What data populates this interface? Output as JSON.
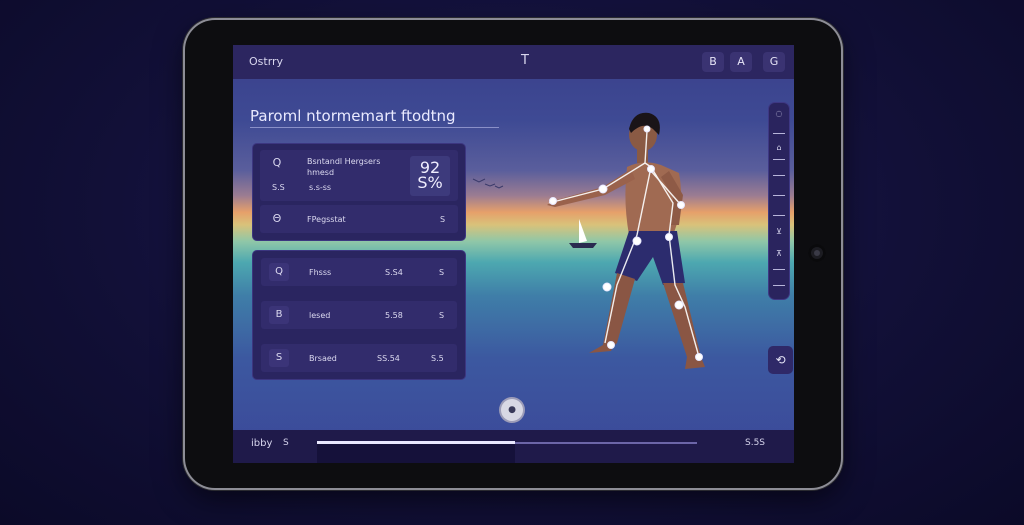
{
  "app": {
    "title": "Ostrry",
    "center_icon": "T",
    "top_buttons": [
      "B",
      "A",
      "G"
    ]
  },
  "main": {
    "heading": "Paroml ntormemart ftodtng"
  },
  "card1": {
    "row1": {
      "icon": "Q",
      "line1": "Bsntandl Hergsers",
      "line2": "hmesd",
      "qr_label": "92\nS%",
      "sub_icon": "S.S",
      "sub_text": "s.s-ss"
    },
    "row2": {
      "icon": "Θ",
      "label": "FPegsstat",
      "right": "S"
    }
  },
  "card2": {
    "rows": [
      {
        "icon": "Q",
        "label": "Fhsss",
        "value": "S.S4",
        "right": "S"
      },
      {
        "icon": "B",
        "label": "lesed",
        "value": "5.58",
        "right": "S"
      },
      {
        "icon": "S",
        "label": "Brsaed",
        "value": "SS.54",
        "right": "S.5"
      }
    ]
  },
  "bottom": {
    "left": "ibby",
    "left_small": "S",
    "right": "S.5S",
    "progress_fraction": 0.52
  },
  "colors": {
    "screen_top": "#3a3f8a",
    "horizon": "#e6a06a",
    "card_bg": "#2a2560",
    "row_bg": "#322c6c",
    "topbar_bg": "#2c2660"
  },
  "icons": {
    "play": "play-icon",
    "side_button": "camera-switch-icon"
  }
}
